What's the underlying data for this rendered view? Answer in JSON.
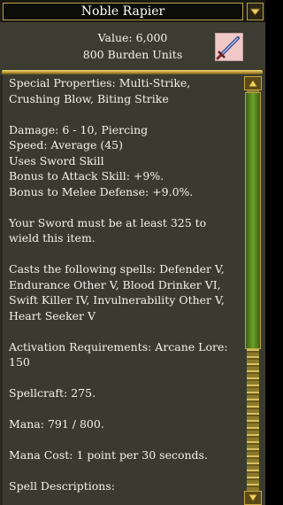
{
  "window": {
    "title": "Noble Rapier"
  },
  "header": {
    "value": "Value: 6,000",
    "burden": "800 Burden Units",
    "icon": "sword-icon"
  },
  "body": {
    "special": "Special Properties: Multi-Strike, Crushing Blow, Biting Strike",
    "damage": "Damage: 6 - 10, Piercing",
    "speed": "Speed: Average (45)",
    "skill": "Uses Sword Skill",
    "attack_bonus": "Bonus to Attack Skill: +9%.",
    "defense_bonus": "Bonus to Melee Defense: +9.0%.",
    "wield_req": "Your Sword must be at least 325 to wield this item.",
    "spells": "Casts the following spells: Defender V, Endurance Other V, Blood Drinker VI, Swift Killer IV, Invulnerability Other V, Heart Seeker V",
    "activation": "Activation Requirements: Arcane Lore: 150",
    "spellcraft": "Spellcraft: 275.",
    "mana": "Mana: 791 / 800.",
    "mana_cost": "Mana Cost: 1 point per 30 seconds.",
    "spell_desc": "Spell Descriptions:"
  },
  "colors": {
    "panel_bg": "#3a3a30",
    "text": "#f2f2ec",
    "gold": "#b9a24a",
    "scroll_thumb": "#6aa02a"
  }
}
